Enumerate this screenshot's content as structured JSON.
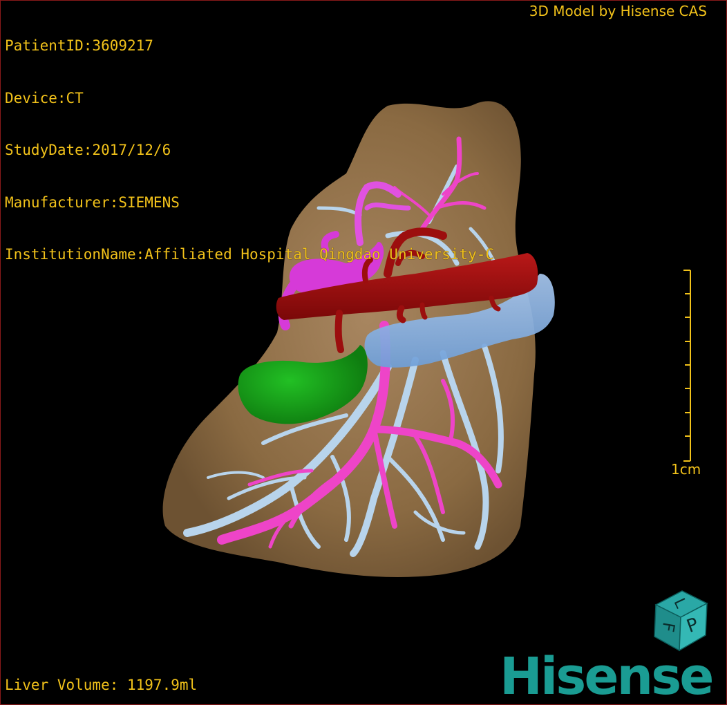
{
  "patient_info": {
    "patient_id": "PatientID:3609217",
    "device": "Device:CT",
    "study_date": "StudyDate:2017/12/6",
    "manufacturer": "Manufacturer:SIEMENS",
    "institution": "InstitutionName:Affiliated Hospital Qingdao University-C"
  },
  "credit": "3D Model by Hisense CAS",
  "liver_volume": "Liver Volume: 1197.9ml",
  "scale_label": "1cm",
  "orientation_cube": {
    "face_right": "P",
    "face_top": "L",
    "face_left": "F"
  },
  "brand": "Hisense",
  "colors": {
    "overlay_text": "#f2c21a",
    "liver": "#8a6a42",
    "artery": "#9c0e0e",
    "portal_vein": "#ee44c8",
    "hepatic_vein": "#b8d4ec",
    "ivc": "#8cb8ee",
    "gallbladder": "#16a018",
    "brand": "#1a9c93"
  },
  "structures": [
    "liver",
    "hepatic-artery",
    "portal-vein",
    "hepatic-vein",
    "inferior-vena-cava",
    "gallbladder"
  ]
}
